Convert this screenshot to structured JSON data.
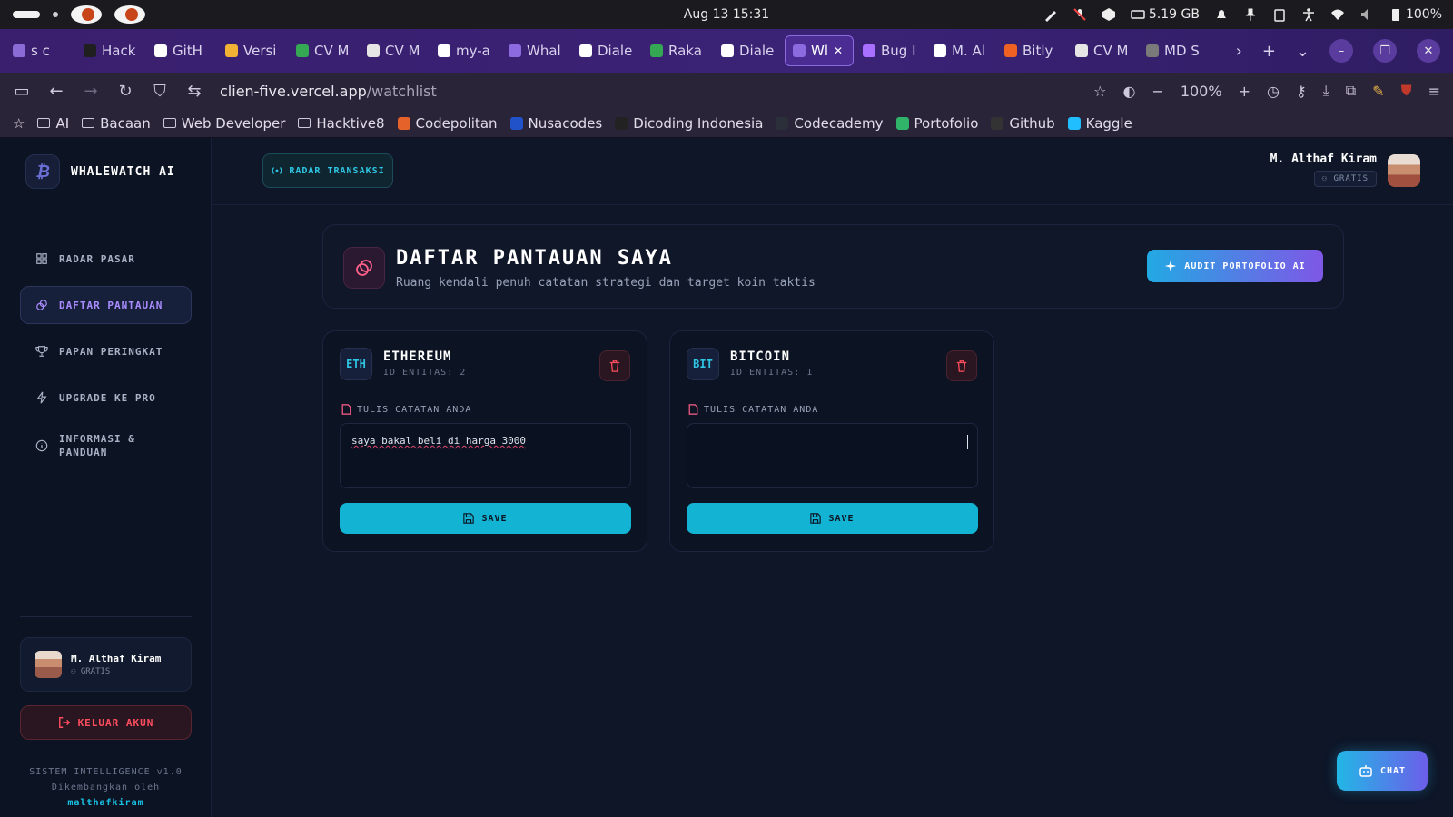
{
  "os": {
    "datetime": "Aug 13  15:31",
    "storage": "5.19 GB",
    "battery": "100%"
  },
  "browser": {
    "tabs": [
      {
        "label": "s c",
        "icon": "back-arrow-icon",
        "color": "#8b6bd6"
      },
      {
        "label": "Hack",
        "icon": "hackmd-icon",
        "color": "#1f1f1f"
      },
      {
        "label": "GitH",
        "icon": "github-icon",
        "color": "#ffffff"
      },
      {
        "label": "Versi",
        "icon": "drive-icon",
        "color": "#f2b233"
      },
      {
        "label": "CV M",
        "icon": "drive-icon",
        "color": "#34a853"
      },
      {
        "label": "CV M",
        "icon": "doc-icon",
        "color": "#e6e6e6"
      },
      {
        "label": "my-a",
        "icon": "vercel-icon",
        "color": "#ffffff"
      },
      {
        "label": "Whal",
        "icon": "app-icon",
        "color": "#8c6be0"
      },
      {
        "label": "Diale",
        "icon": "vercel-icon",
        "color": "#ffffff"
      },
      {
        "label": "Raka",
        "icon": "drive-icon",
        "color": "#34a853"
      },
      {
        "label": "Diale",
        "icon": "vercel-icon",
        "color": "#ffffff"
      },
      {
        "label": "Wl",
        "icon": "app-icon",
        "color": "#8c6be0",
        "active": true
      },
      {
        "label": "Bug I",
        "icon": "bolt-icon",
        "color": "#a970ff"
      },
      {
        "label": "M. Al",
        "icon": "vercel-icon",
        "color": "#ffffff"
      },
      {
        "label": "Bitly",
        "icon": "bitly-icon",
        "color": "#ee6123"
      },
      {
        "label": "CV M",
        "icon": "doc-icon",
        "color": "#e6e6e6"
      },
      {
        "label": "MD S",
        "icon": "shield-icon",
        "color": "#7a7a7a"
      }
    ],
    "url_host": "clien-five.vercel.app",
    "url_path": "/watchlist",
    "zoom": "100%",
    "bookmarks": [
      {
        "label": "AI",
        "type": "folder"
      },
      {
        "label": "Bacaan",
        "type": "folder"
      },
      {
        "label": "Web Developer",
        "type": "folder"
      },
      {
        "label": "Hacktive8",
        "type": "folder"
      },
      {
        "label": "Codepolitan",
        "type": "site",
        "color": "#e6622b"
      },
      {
        "label": "Nusacodes",
        "type": "site",
        "color": "#2152c9"
      },
      {
        "label": "Dicoding Indonesia",
        "type": "site",
        "color": "#222222"
      },
      {
        "label": "Codecademy",
        "type": "site",
        "color": "#2a2f3a"
      },
      {
        "label": "Portofolio",
        "type": "site",
        "color": "#2fb46a"
      },
      {
        "label": "Github",
        "type": "site",
        "color": "#333333"
      },
      {
        "label": "Kaggle",
        "type": "site",
        "color": "#20beff"
      }
    ]
  },
  "app": {
    "brand": "WHALEWATCH AI",
    "brand_glyph": "₿",
    "menu": [
      {
        "label": "RADAR PASAR",
        "icon": "grid-icon"
      },
      {
        "label": "DAFTAR PANTAUAN",
        "icon": "link-icon",
        "active": true
      },
      {
        "label": "PAPAN PERINGKAT",
        "icon": "trophy-icon"
      },
      {
        "label": "UPGRADE KE PRO",
        "icon": "bolt-icon"
      },
      {
        "label": "INFORMASI & PANDUAN",
        "icon": "info-icon"
      }
    ],
    "user": {
      "name": "M. Althaf Kiram",
      "tier": "GRATIS"
    },
    "logout_label": "KELUAR AKUN",
    "footer": {
      "line1": "SISTEM INTELLIGENCE v1.0",
      "line2": "Dikembangkan oleh",
      "author": "malthafkiram"
    },
    "header": {
      "radar_label": "RADAR TRANSAKSI"
    },
    "page": {
      "title": "DAFTAR PANTAUAN SAYA",
      "subtitle": "Ruang kendali penuh catatan strategi dan target koin taktis",
      "audit_label": "AUDIT PORTOFOLIO AI"
    },
    "watchlist": [
      {
        "symbol": "ETH",
        "name": "ETHEREUM",
        "id_text": "ID ENTITAS: 2",
        "note_label": "TULIS CATATAN ANDA",
        "note": "saya bakal beli di harga 3000",
        "save_label": "SAVE"
      },
      {
        "symbol": "BIT",
        "name": "BITCOIN",
        "id_text": "ID ENTITAS: 1",
        "note_label": "TULIS CATATAN ANDA",
        "note": "",
        "save_label": "SAVE"
      }
    ],
    "chat_label": "CHAT",
    "colors": {
      "accent_cyan": "#12b3d3",
      "accent_purple": "#a98cff",
      "danger": "#ff4d5e",
      "bg": "#0e1628"
    }
  }
}
